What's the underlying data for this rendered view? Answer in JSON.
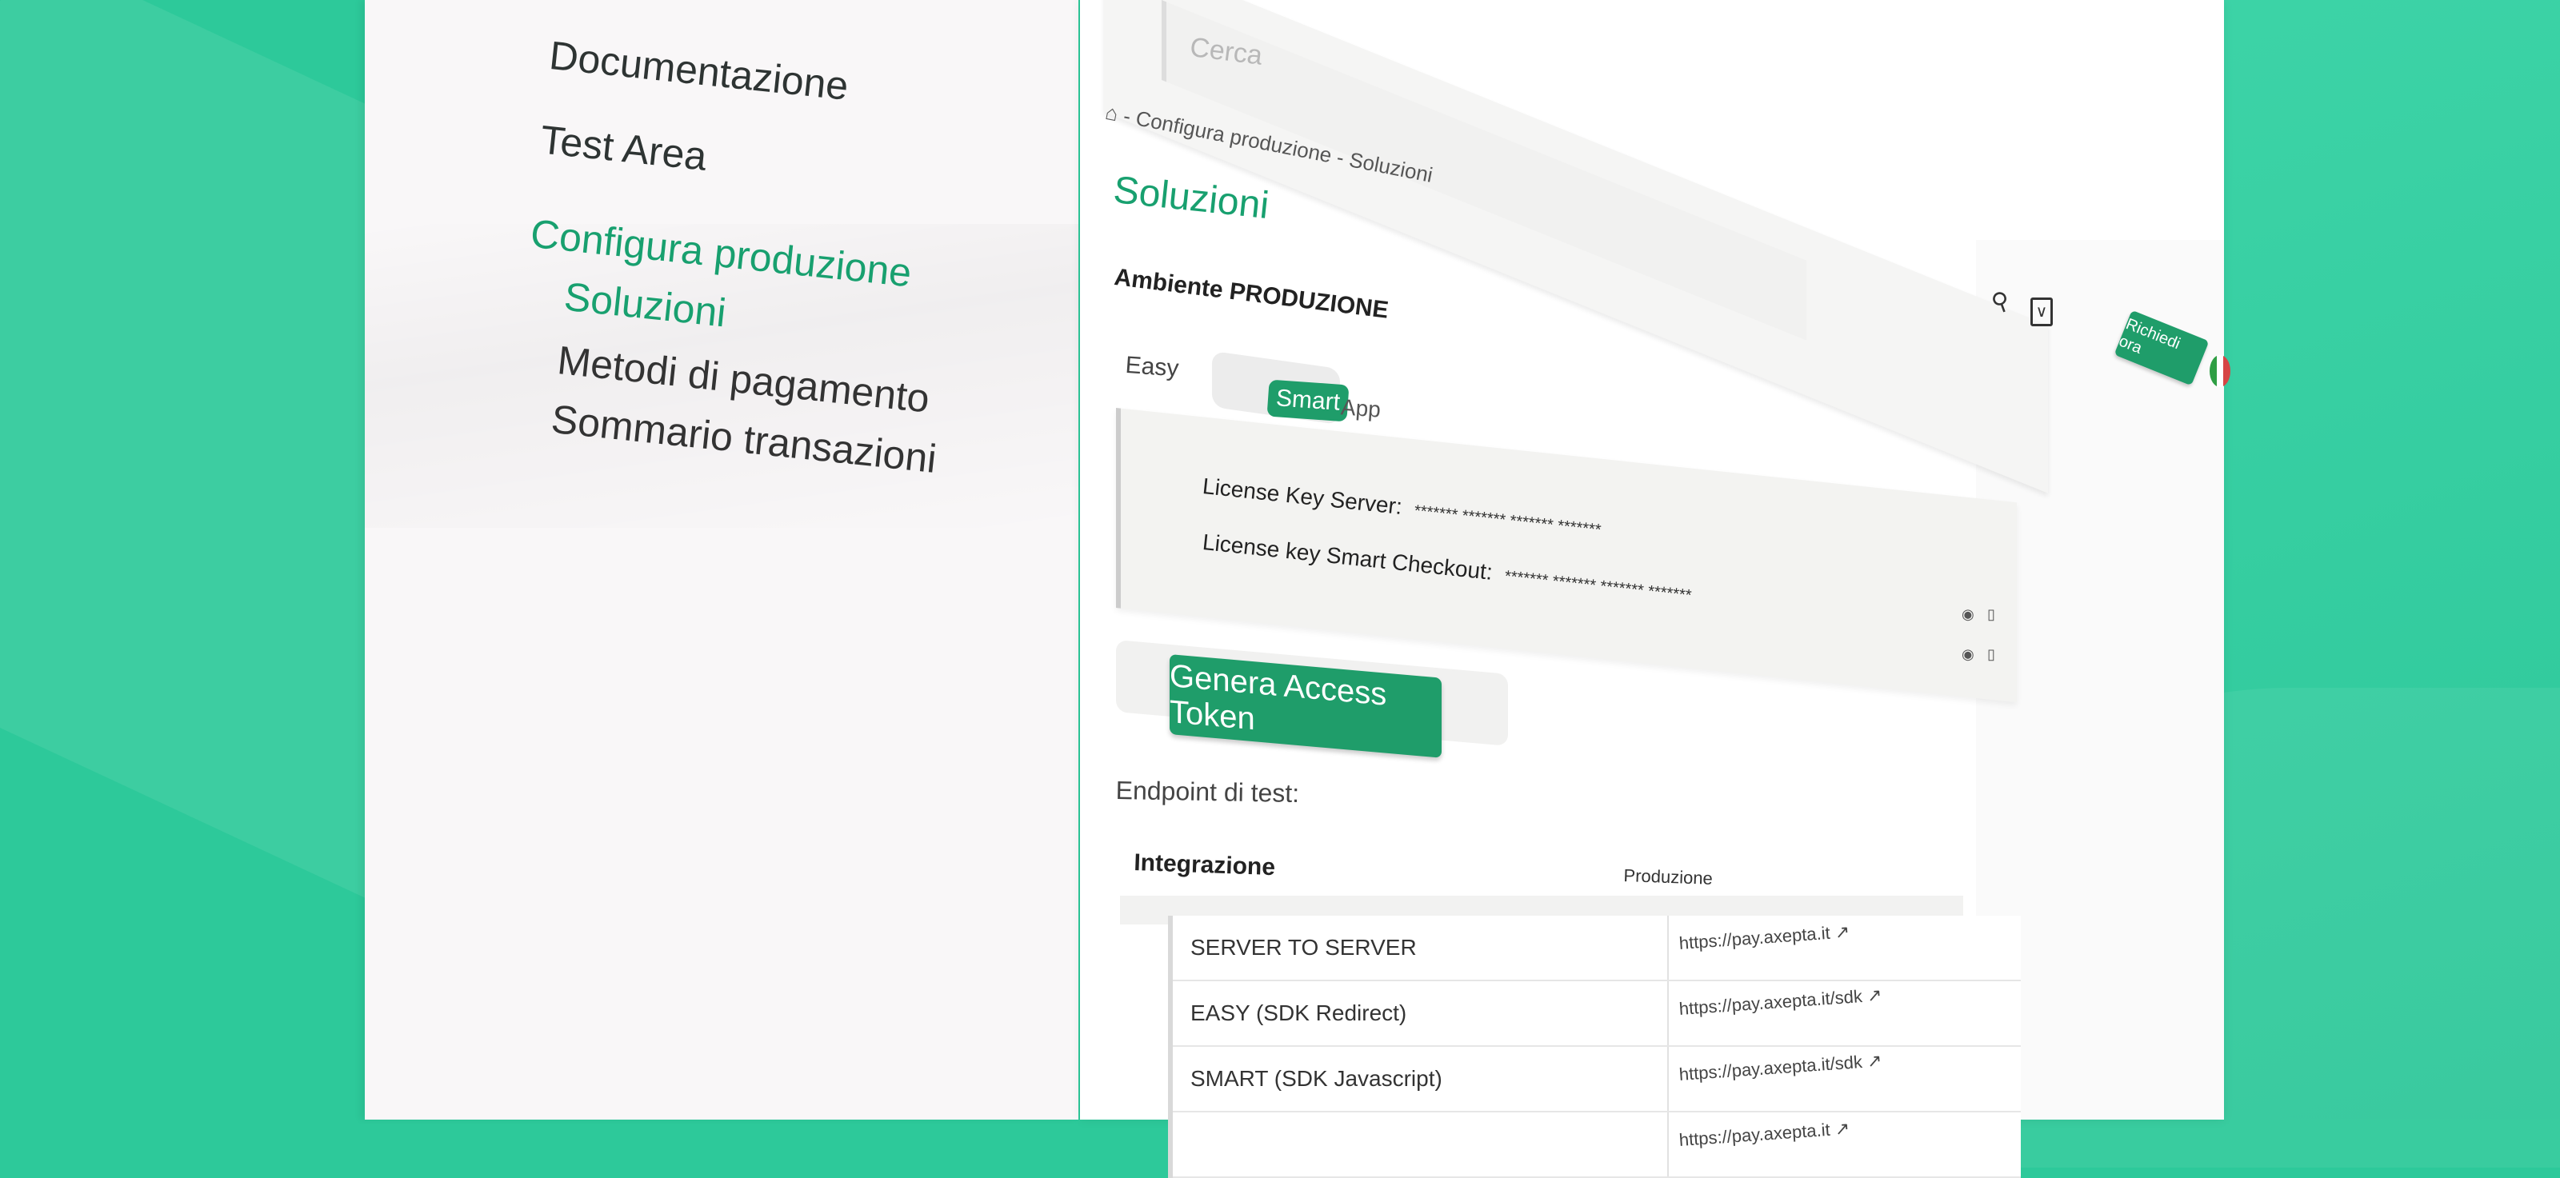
{
  "sidebar": {
    "items": [
      {
        "label": "Documentazione"
      },
      {
        "label": "Test Area"
      },
      {
        "label": "Configura produzione"
      },
      {
        "label": "Soluzioni"
      },
      {
        "label": "Metodi di pagamento"
      },
      {
        "label": "Sommario transazioni"
      }
    ]
  },
  "header": {
    "search_placeholder": "Cerca",
    "search_icon": "magnifier",
    "mail_icon": "envelope",
    "cta_label": "Richiedi ora",
    "flag_colors": [
      "#2f9e44",
      "#ffffff",
      "#d64545"
    ]
  },
  "breadcrumb": {
    "home_icon": "home",
    "text": "- Configura produzione - Soluzioni"
  },
  "page": {
    "title": "Soluzioni",
    "env_title": "Ambiente PRODUZIONE"
  },
  "tabs": {
    "easy": "Easy",
    "smart": "Smart",
    "app": "App"
  },
  "keys": {
    "server_label": "License Key Server:",
    "server_value": "******* ******* ******* *******",
    "smart_label": "License key Smart Checkout:",
    "smart_value": "******* ******* ******* *******",
    "icons": [
      "eye-icon",
      "copy-icon"
    ]
  },
  "actions": {
    "generate_token": "Genera Access Token"
  },
  "endpoint": {
    "label": "Endpoint di test:"
  },
  "table": {
    "headers": {
      "integration": "Integrazione",
      "production": "Produzione"
    },
    "rows": [
      {
        "name": "SERVER TO SERVER",
        "url": "https://pay.axepta.it"
      },
      {
        "name": "EASY (SDK Redirect)",
        "url": "https://pay.axepta.it/sdk"
      },
      {
        "name": "SMART (SDK Javascript)",
        "url": "https://pay.axepta.it/sdk"
      },
      {
        "name": "",
        "url": "https://pay.axepta.it"
      }
    ]
  },
  "colors": {
    "brand_green": "#1f9d6a",
    "active_green": "#18a06f",
    "background": "#2dc99a"
  }
}
